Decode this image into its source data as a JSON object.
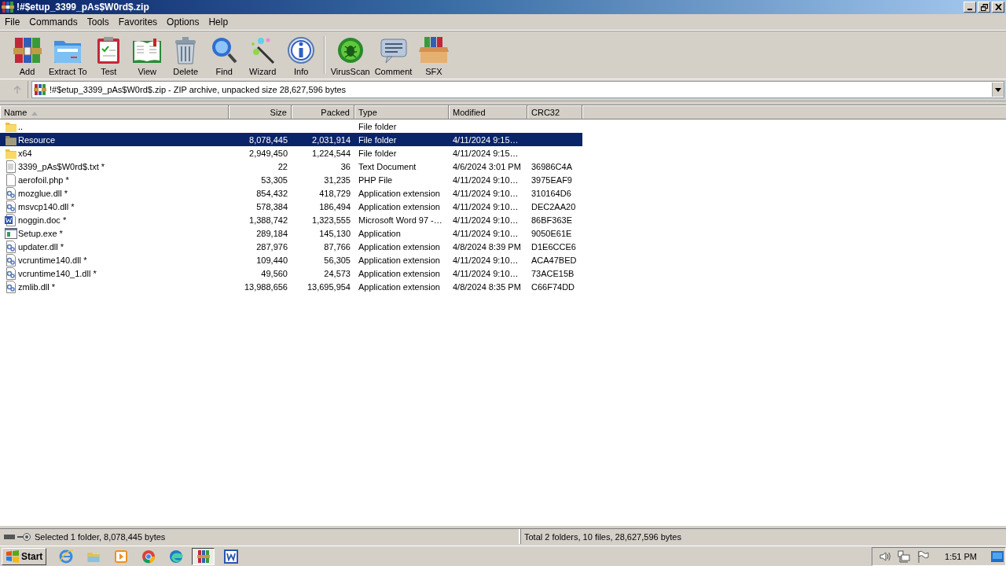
{
  "window": {
    "title": "!#$etup_3399_pAs$W0rd$.zip"
  },
  "menu": [
    "File",
    "Commands",
    "Tools",
    "Favorites",
    "Options",
    "Help"
  ],
  "toolbar": [
    {
      "label": "Add"
    },
    {
      "label": "Extract To"
    },
    {
      "label": "Test"
    },
    {
      "label": "View"
    },
    {
      "label": "Delete"
    },
    {
      "label": "Find"
    },
    {
      "label": "Wizard"
    },
    {
      "label": "Info"
    },
    {
      "label": "VirusScan"
    },
    {
      "label": "Comment"
    },
    {
      "label": "SFX"
    }
  ],
  "address": {
    "value": "!#$etup_3399_pAs$W0rd$.zip - ZIP archive, unpacked size 28,627,596 bytes"
  },
  "table": {
    "columns": [
      {
        "label": "Name",
        "sorted": true
      },
      {
        "label": "Size"
      },
      {
        "label": "Packed"
      },
      {
        "label": "Type"
      },
      {
        "label": "Modified"
      },
      {
        "label": "CRC32"
      }
    ],
    "rows": [
      {
        "kind": "folder",
        "name": "..",
        "size": "",
        "packed": "",
        "type": "File folder",
        "modified": "",
        "crc": "",
        "selected": false
      },
      {
        "kind": "folder",
        "name": "Resource",
        "size": "8,078,445",
        "packed": "2,031,914",
        "type": "File folder",
        "modified": "4/11/2024 9:15…",
        "crc": "",
        "selected": true
      },
      {
        "kind": "folder",
        "name": "x64",
        "size": "2,949,450",
        "packed": "1,224,544",
        "type": "File folder",
        "modified": "4/11/2024 9:15…",
        "crc": "",
        "selected": false
      },
      {
        "kind": "text",
        "name": "3399_pAs$W0rd$.txt *",
        "size": "22",
        "packed": "36",
        "type": "Text Document",
        "modified": "4/6/2024 3:01 PM",
        "crc": "36986C4A",
        "selected": false
      },
      {
        "kind": "file",
        "name": "aerofoil.php *",
        "size": "53,305",
        "packed": "31,235",
        "type": "PHP File",
        "modified": "4/11/2024 9:10…",
        "crc": "3975EAF9",
        "selected": false
      },
      {
        "kind": "dll",
        "name": "mozglue.dll *",
        "size": "854,432",
        "packed": "418,729",
        "type": "Application extension",
        "modified": "4/11/2024 9:10…",
        "crc": "310164D6",
        "selected": false
      },
      {
        "kind": "dll",
        "name": "msvcp140.dll *",
        "size": "578,384",
        "packed": "186,494",
        "type": "Application extension",
        "modified": "4/11/2024 9:10…",
        "crc": "DEC2AA20",
        "selected": false
      },
      {
        "kind": "doc",
        "name": "noggin.doc *",
        "size": "1,388,742",
        "packed": "1,323,555",
        "type": "Microsoft Word 97 -…",
        "modified": "4/11/2024 9:10…",
        "crc": "86BF363E",
        "selected": false
      },
      {
        "kind": "exe",
        "name": "Setup.exe *",
        "size": "289,184",
        "packed": "145,130",
        "type": "Application",
        "modified": "4/11/2024 9:10…",
        "crc": "9050E61E",
        "selected": false
      },
      {
        "kind": "dll",
        "name": "updater.dll *",
        "size": "287,976",
        "packed": "87,766",
        "type": "Application extension",
        "modified": "4/8/2024 8:39 PM",
        "crc": "D1E6CCE6",
        "selected": false
      },
      {
        "kind": "dll",
        "name": "vcruntime140.dll *",
        "size": "109,440",
        "packed": "56,305",
        "type": "Application extension",
        "modified": "4/11/2024 9:10…",
        "crc": "ACA47BED",
        "selected": false
      },
      {
        "kind": "dll",
        "name": "vcruntime140_1.dll *",
        "size": "49,560",
        "packed": "24,573",
        "type": "Application extension",
        "modified": "4/11/2024 9:10…",
        "crc": "73ACE15B",
        "selected": false
      },
      {
        "kind": "dll",
        "name": "zmlib.dll *",
        "size": "13,988,656",
        "packed": "13,695,954",
        "type": "Application extension",
        "modified": "4/8/2024 8:35 PM",
        "crc": "C66F74DD",
        "selected": false
      }
    ]
  },
  "status_bar": {
    "left": "Selected 1 folder, 8,078,445 bytes",
    "right": "Total 2 folders, 10 files, 28,627,596 bytes"
  },
  "taskbar": {
    "start": "Start",
    "apps": [
      {
        "active": false
      },
      {
        "active": false
      },
      {
        "active": false
      },
      {
        "active": false
      },
      {
        "active": false
      },
      {
        "active": true
      },
      {
        "active": false
      }
    ],
    "clock": "1:51 PM"
  }
}
